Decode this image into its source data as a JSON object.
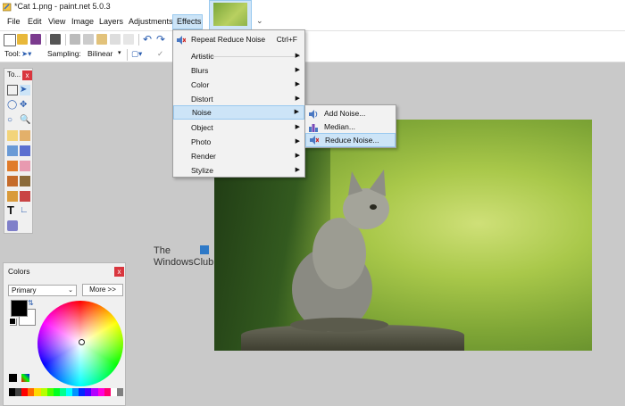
{
  "window": {
    "title": "*Cat 1.png - paint.net 5.0.3"
  },
  "menubar": {
    "items": [
      "File",
      "Edit",
      "View",
      "Image",
      "Layers",
      "Adjustments",
      "Effects"
    ],
    "active": "Effects"
  },
  "toolbar2": {
    "tool_label": "Tool:",
    "sampling_label": "Sampling:",
    "sampling_value": "Bilinear"
  },
  "tools_window": {
    "title": "To..."
  },
  "colors_window": {
    "title": "Colors",
    "primary_select": "Primary",
    "more_button": "More >>",
    "primary_color": "#000000",
    "secondary_color": "#ffffff",
    "palette": [
      "#000000",
      "#404040",
      "#ff0000",
      "#ff6a00",
      "#ffd800",
      "#b6ff00",
      "#4cff00",
      "#00ff21",
      "#00ff90",
      "#00ffff",
      "#0094ff",
      "#0026ff",
      "#4800ff",
      "#b200ff",
      "#ff00dc",
      "#ff006e",
      "#ffffff",
      "#808080"
    ]
  },
  "effects_menu": {
    "repeat_label": "Repeat Reduce Noise",
    "repeat_shortcut": "Ctrl+F",
    "items": [
      "Artistic",
      "Blurs",
      "Color",
      "Distort",
      "Noise",
      "Object",
      "Photo",
      "Render",
      "Stylize"
    ],
    "highlighted": "Noise"
  },
  "noise_submenu": {
    "items": [
      "Add Noise...",
      "Median...",
      "Reduce Noise..."
    ],
    "highlighted": "Reduce Noise..."
  },
  "watermark": {
    "line1": "The",
    "line2": "WindowsClub"
  },
  "colors": {
    "accent": "#cce4f7",
    "accent_border": "#99c9ef",
    "close": "#d9363e"
  }
}
